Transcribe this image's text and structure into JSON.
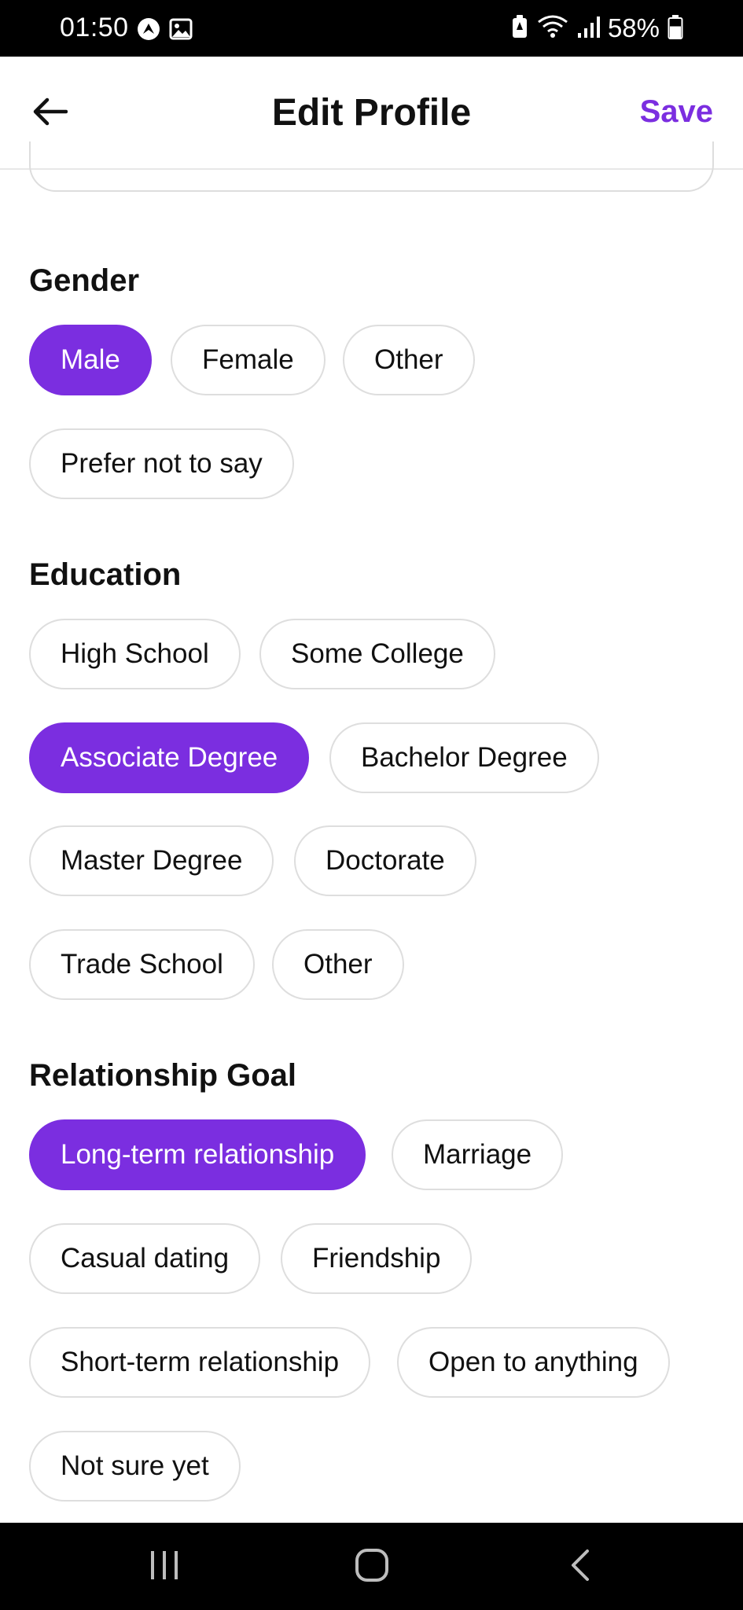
{
  "status_bar": {
    "time": "01:50",
    "battery_percent": "58%",
    "battery_level": 0.58
  },
  "header": {
    "title": "Edit Profile",
    "save_label": "Save",
    "back_icon": "arrow-left-icon"
  },
  "colors": {
    "accent": "#7b2ee0",
    "chip_border": "#dedede",
    "text": "#111111"
  },
  "sections": {
    "gender": {
      "title": "Gender",
      "options": [
        "Male",
        "Female",
        "Other",
        "Prefer not to say"
      ],
      "selected": "Male"
    },
    "education": {
      "title": "Education",
      "options": [
        "High School",
        "Some College",
        "Associate Degree",
        "Bachelor Degree",
        "Master Degree",
        "Doctorate",
        "Trade School",
        "Other"
      ],
      "selected": "Associate Degree"
    },
    "relationship_goal": {
      "title": "Relationship Goal",
      "options": [
        "Long-term relationship",
        "Marriage",
        "Casual dating",
        "Friendship",
        "Short-term relationship",
        "Open to anything",
        "Not sure yet"
      ],
      "selected": "Long-term relationship"
    }
  },
  "nav_bar": {
    "icons": [
      "recent-apps-icon",
      "home-icon",
      "back-icon"
    ]
  }
}
